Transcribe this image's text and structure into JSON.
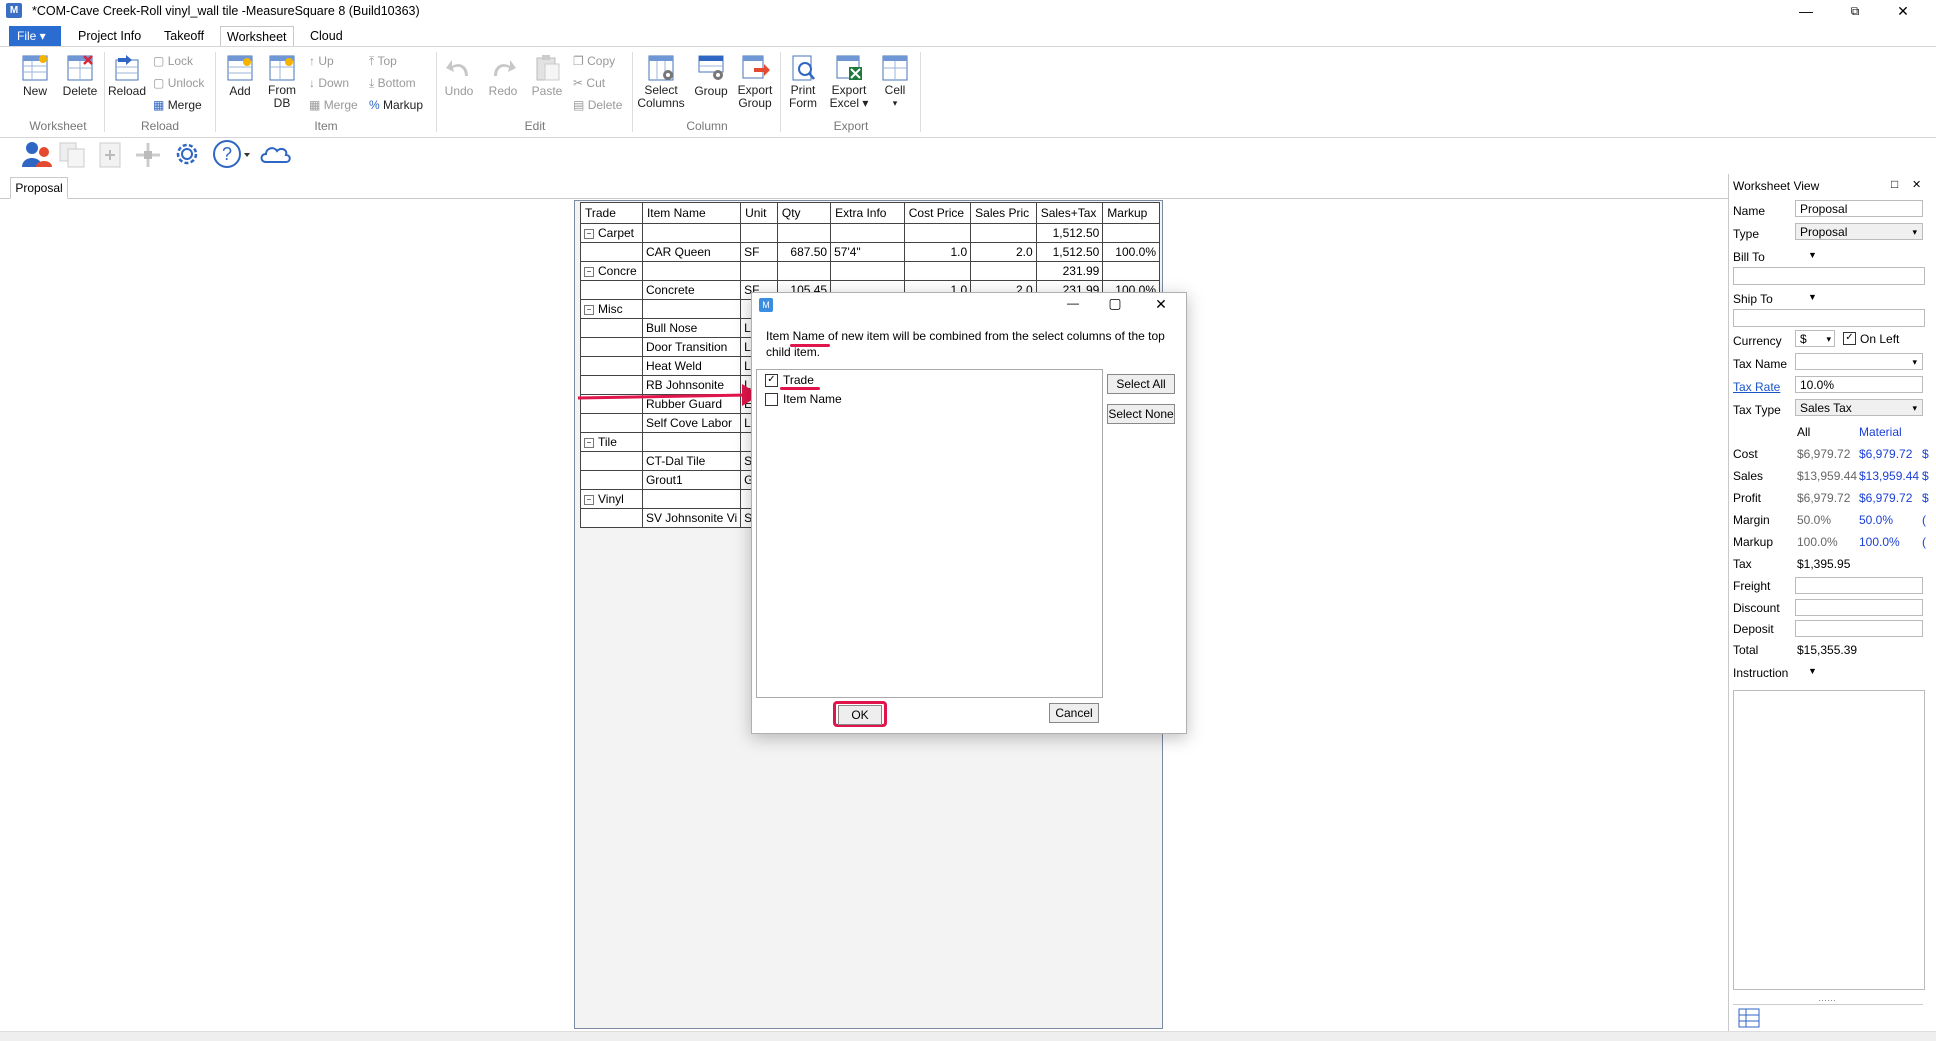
{
  "window": {
    "title": "*COM-Cave Creek-Roll vinyl_wall tile -MeasureSquare 8 (Build10363)",
    "app_icon": "M",
    "minimize": "—",
    "restore": "⧉",
    "close": "✕"
  },
  "menu": {
    "file": "File ▾",
    "tabs": [
      "Project Info",
      "Takeoff",
      "Worksheet",
      "Cloud"
    ]
  },
  "ribbon": {
    "worksheet_group": "Worksheet",
    "reload_group": "Reload",
    "item_group": "Item",
    "edit_group": "Edit",
    "column_group": "Column",
    "export_group": "Export",
    "new": "New",
    "delete": "Delete",
    "reload": "Reload",
    "lock": "Lock",
    "unlock": "Unlock",
    "merge": "Merge",
    "add": "Add",
    "from_db_1": "From",
    "from_db_2": "DB",
    "up": "Up",
    "down": "Down",
    "item_merge": "Merge",
    "top": "Top",
    "bottom": "Bottom",
    "markup": "Markup",
    "undo": "Undo",
    "redo": "Redo",
    "paste": "Paste",
    "copy": "Copy",
    "cut": "Cut",
    "edit_delete": "Delete",
    "select_columns_1": "Select",
    "select_columns_2": "Columns",
    "group": "Group",
    "export_group_1": "Export",
    "export_group_2": "Group",
    "print_form_1": "Print",
    "print_form_2": "Form",
    "export_excel_1": "Export",
    "export_excel_2": "Excel ▾",
    "cell": "Cell",
    "cell_arrow": "▾"
  },
  "doc_tab": "Proposal",
  "grid": {
    "headers": [
      "Trade",
      "Item Name",
      "Unit",
      "Qty",
      "Extra Info",
      "Cost Price",
      "Sales Pric",
      "Sales+Tax",
      "Markup"
    ],
    "rows": [
      {
        "group": true,
        "trade": "Carpet",
        "item": "",
        "unit": "",
        "qty": "",
        "extra": "",
        "cost": "",
        "sales": "",
        "salestax": "1,512.50",
        "markup": ""
      },
      {
        "group": false,
        "trade": "",
        "item": "CAR Queen",
        "unit": "SF",
        "qty": "687.50",
        "extra": "57'4\"",
        "cost": "1.0",
        "sales": "2.0",
        "salestax": "1,512.50",
        "markup": "100.0%"
      },
      {
        "group": true,
        "trade": "Concre",
        "item": "",
        "unit": "",
        "qty": "",
        "extra": "",
        "cost": "",
        "sales": "",
        "salestax": "231.99",
        "markup": ""
      },
      {
        "group": false,
        "trade": "",
        "item": "Concrete",
        "unit": "SF",
        "qty": "105.45",
        "extra": "",
        "cost": "1.0",
        "sales": "2.0",
        "salestax": "231.99",
        "markup": "100.0%"
      },
      {
        "group": true,
        "trade": "Misc",
        "item": "",
        "unit": "",
        "qty": "",
        "extra": "",
        "cost": "",
        "sales": "",
        "salestax": "",
        "markup": ""
      },
      {
        "group": false,
        "trade": "",
        "item": "Bull Nose",
        "unit": "LF",
        "qty": "",
        "extra": "",
        "cost": "",
        "sales": "",
        "salestax": "",
        "markup": ""
      },
      {
        "group": false,
        "trade": "",
        "item": "Door Transition",
        "unit": "LF",
        "qty": "",
        "extra": "",
        "cost": "",
        "sales": "",
        "salestax": "",
        "markup": ""
      },
      {
        "group": false,
        "trade": "",
        "item": "Heat Weld",
        "unit": "LF",
        "qty": "",
        "extra": "",
        "cost": "",
        "sales": "",
        "salestax": "",
        "markup": ""
      },
      {
        "group": false,
        "trade": "",
        "item": "RB Johnsonite",
        "unit": "LF",
        "qty": "",
        "extra": "",
        "cost": "",
        "sales": "",
        "salestax": "",
        "markup": ""
      },
      {
        "group": false,
        "trade": "",
        "item": "Rubber Guard",
        "unit": "EA",
        "qty": "",
        "extra": "",
        "cost": "",
        "sales": "",
        "salestax": "",
        "markup": ""
      },
      {
        "group": false,
        "trade": "",
        "item": "Self Cove Labor",
        "unit": "LF",
        "qty": "",
        "extra": "",
        "cost": "",
        "sales": "",
        "salestax": "",
        "markup": ""
      },
      {
        "group": true,
        "trade": "Tile",
        "item": "",
        "unit": "",
        "qty": "",
        "extra": "",
        "cost": "",
        "sales": "",
        "salestax": "",
        "markup": ""
      },
      {
        "group": false,
        "trade": "",
        "item": "CT-Dal Tile",
        "unit": "SF",
        "qty": "",
        "extra": "",
        "cost": "",
        "sales": "",
        "salestax": "",
        "markup": ""
      },
      {
        "group": false,
        "trade": "",
        "item": "Grout1",
        "unit": "Gal",
        "qty": "",
        "extra": "",
        "cost": "",
        "sales": "",
        "salestax": "",
        "markup": ""
      },
      {
        "group": true,
        "trade": "Vinyl",
        "item": "",
        "unit": "",
        "qty": "",
        "extra": "",
        "cost": "",
        "sales": "",
        "salestax": "",
        "markup": ""
      },
      {
        "group": false,
        "trade": "",
        "item": "SV Johnsonite Vi",
        "unit": "SF",
        "qty": "",
        "extra": "",
        "cost": "",
        "sales": "",
        "salestax": "",
        "markup": ""
      }
    ]
  },
  "dialog": {
    "icon": "M",
    "minimize": "—",
    "maximize": "▢",
    "close": "✕",
    "message": "Item Name of new item will be combined from the select columns of the top child item.",
    "options": [
      {
        "label": "Trade",
        "checked": true,
        "mark": "✓"
      },
      {
        "label": "Item Name",
        "checked": false,
        "mark": ""
      }
    ],
    "select_all": "Select All",
    "select_none": "Select None",
    "ok": "OK",
    "cancel": "Cancel"
  },
  "panel": {
    "title": "Worksheet View",
    "pin": "□",
    "close": "✕",
    "name_label": "Name",
    "name_value": "Proposal",
    "type_label": "Type",
    "type_value": "Proposal",
    "bill_to": "Bill To",
    "ship_to": "Ship To",
    "currency_label": "Currency",
    "currency_value": "$",
    "on_left": "On Left",
    "on_left_mark": "✓",
    "tax_name": "Tax Name",
    "tax_rate": "Tax Rate",
    "tax_rate_value": "10.0%",
    "tax_type": "Tax Type",
    "tax_type_value": "Sales Tax",
    "col_all": "All",
    "col_material": "Material",
    "dropdown": "▾",
    "caret": "▼",
    "summary": [
      {
        "label": "Cost",
        "all": "$6,979.72",
        "material": "$6,979.72",
        "extra": "$"
      },
      {
        "label": "Sales",
        "all": "$13,959.44",
        "material": "$13,959.44",
        "extra": "$"
      },
      {
        "label": "Profit",
        "all": "$6,979.72",
        "material": "$6,979.72",
        "extra": "$"
      },
      {
        "label": "Margin",
        "all": "50.0%",
        "material": "50.0%",
        "extra": "("
      },
      {
        "label": "Markup",
        "all": "100.0%",
        "material": "100.0%",
        "extra": "("
      }
    ],
    "tax_label": "Tax",
    "tax_value": "$1,395.95",
    "freight": "Freight",
    "discount": "Discount",
    "deposit": "Deposit",
    "total_label": "Total",
    "total_value": "$15,355.39",
    "instruction": "Instruction",
    "grip": "……"
  }
}
